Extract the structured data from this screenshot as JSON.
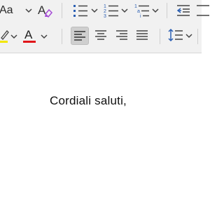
{
  "ribbon": {
    "font_size_label": "Aa",
    "font_color_letter": "A",
    "highlight_color": "#f2e600",
    "font_color": "#e0161a",
    "clear_format_accent": "#a54bd6",
    "active_align": "align-left"
  },
  "document": {
    "text": "Cordiali saluti,"
  }
}
